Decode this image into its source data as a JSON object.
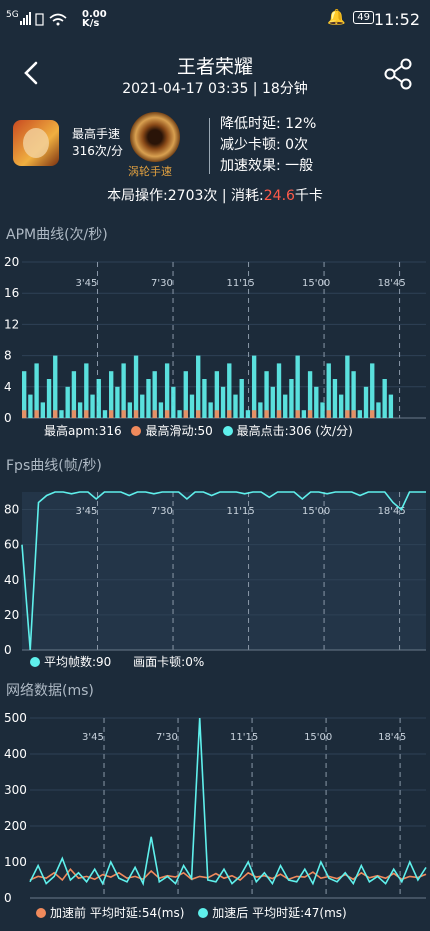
{
  "status_bar": {
    "signal": "5G",
    "net_speed_value": "0.00",
    "net_speed_unit": "K/s",
    "battery": "49",
    "time": "11:52"
  },
  "header": {
    "title": "王者荣耀",
    "subtitle": "2021-04-17 03:35 | 18分钟"
  },
  "icons": {
    "back": "chevron-left-icon",
    "share": "share-icon",
    "bell": "bell-icon"
  },
  "profile": {
    "max_speed_label": "最高手速",
    "max_speed_value": "316次/分",
    "badge_label": "涡轮手速",
    "effects": [
      "降低时延:  12%",
      "减少卡顿:  0次",
      "加速效果:  一般"
    ]
  },
  "summary": {
    "ops": "本局操作:2703次  |  消耗:",
    "energy": "24.6",
    "energy_unit": "千卡"
  },
  "colors": {
    "bg": "#1c2b3a",
    "cyan": "#5ff0ec",
    "orange": "#f08a5c",
    "red": "#ff5a4a"
  },
  "time_ticks": [
    "3'45",
    "7'30",
    "11'15",
    "15'00",
    "18'45"
  ],
  "apm": {
    "title": "APM曲线(次/秒)",
    "yticks": [
      "20",
      "16",
      "12",
      "8",
      "4",
      "0"
    ],
    "legend_a": "最高apm:316",
    "legend_b": "最高滑动:50",
    "legend_c": "最高点击:306 (次/分)"
  },
  "fps": {
    "title": "Fps曲线(帧/秒)",
    "yticks": [
      "80",
      "60",
      "40",
      "20",
      "0"
    ],
    "legend_a": "平均帧数:90",
    "legend_b": "画面卡顿:0%"
  },
  "net": {
    "title": "网络数据(ms)",
    "yticks": [
      "500",
      "400",
      "300",
      "200",
      "100",
      "0"
    ],
    "legend_a": "加速前  平均时延:54(ms)",
    "legend_b": "加速后  平均时延:47(ms)"
  },
  "chart_data": [
    {
      "type": "area",
      "title": "APM曲线(次/秒)",
      "x_ticks": [
        "3'45",
        "7'30",
        "11'15",
        "15'00",
        "18'45"
      ],
      "ylim": [
        0,
        20
      ],
      "series": [
        {
          "name": "最高点击",
          "color": "#5ff0ec",
          "values": [
            6,
            3,
            7,
            2,
            5,
            8,
            1,
            4,
            6,
            2,
            7,
            3,
            5,
            1,
            6,
            4,
            7,
            2,
            8,
            3,
            5,
            6,
            2,
            7,
            4,
            1,
            6,
            3,
            8,
            5,
            2,
            6,
            4,
            7,
            3,
            5,
            1,
            8,
            2,
            6,
            4,
            7,
            3,
            5,
            8,
            1,
            6,
            4,
            2,
            7,
            5,
            3,
            8,
            6,
            1,
            4,
            7,
            2,
            5,
            3,
            0,
            0,
            0,
            0,
            0,
            0
          ]
        },
        {
          "name": "最高滑动",
          "color": "#f08a5c",
          "values": [
            1,
            0,
            1,
            0,
            0,
            1,
            0,
            0,
            1,
            0,
            1,
            0,
            0,
            0,
            1,
            0,
            1,
            0,
            1,
            0,
            0,
            1,
            0,
            1,
            0,
            0,
            1,
            0,
            1,
            0,
            0,
            1,
            0,
            1,
            0,
            0,
            0,
            1,
            0,
            1,
            0,
            1,
            0,
            0,
            1,
            0,
            1,
            0,
            0,
            1,
            0,
            0,
            1,
            1,
            0,
            0,
            1,
            0,
            0,
            0,
            0,
            0,
            0,
            0,
            0,
            0
          ]
        }
      ]
    },
    {
      "type": "line",
      "title": "Fps曲线(帧/秒)",
      "x_ticks": [
        "3'45",
        "7'30",
        "11'15",
        "15'00",
        "18'45"
      ],
      "ylim": [
        0,
        90
      ],
      "series": [
        {
          "name": "平均帧数",
          "color": "#5ff0ec",
          "values": [
            60,
            0,
            84,
            88,
            90,
            90,
            89,
            90,
            90,
            86,
            90,
            90,
            90,
            88,
            90,
            90,
            89,
            90,
            90,
            90,
            86,
            90,
            90,
            88,
            90,
            90,
            90,
            89,
            90,
            90,
            87,
            90,
            90,
            90,
            86,
            90,
            90,
            89,
            90,
            90,
            90,
            88,
            90,
            90,
            90,
            84,
            80,
            90,
            90,
            90
          ]
        }
      ]
    },
    {
      "type": "line",
      "title": "网络数据(ms)",
      "x_ticks": [
        "3'45",
        "7'30",
        "11'15",
        "15'00",
        "18'45"
      ],
      "ylim": [
        0,
        500
      ],
      "series": [
        {
          "name": "加速前",
          "color": "#f08a5c",
          "values": [
            50,
            60,
            55,
            70,
            50,
            80,
            55,
            60,
            52,
            65,
            58,
            70,
            55,
            60,
            52,
            75,
            55,
            62,
            58,
            70,
            52,
            60,
            56,
            68,
            55,
            62,
            50,
            70,
            58,
            62,
            54,
            66,
            52,
            60,
            58,
            72,
            55,
            60,
            54,
            65,
            52,
            70,
            56,
            62,
            55,
            68,
            52,
            60,
            57,
            66
          ]
        },
        {
          "name": "加速后",
          "color": "#5ff0ec",
          "values": [
            45,
            90,
            40,
            60,
            110,
            50,
            70,
            45,
            80,
            40,
            100,
            55,
            45,
            85,
            40,
            170,
            45,
            60,
            40,
            90,
            55,
            500,
            50,
            45,
            80,
            40,
            60,
            100,
            45,
            70,
            40,
            90,
            50,
            45,
            80,
            40,
            100,
            55,
            45,
            70,
            40,
            90,
            45,
            60,
            40,
            80,
            45,
            100,
            50,
            85
          ]
        }
      ]
    }
  ]
}
